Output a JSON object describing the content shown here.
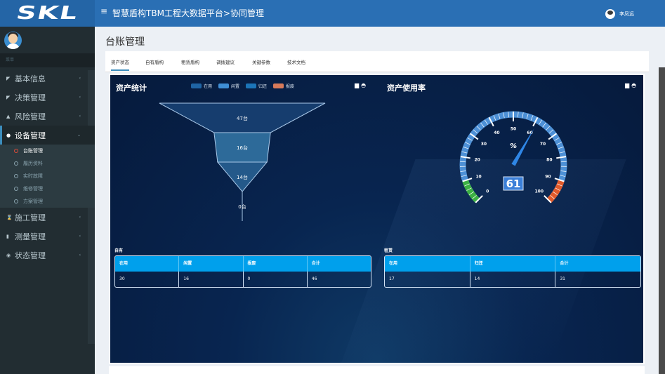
{
  "header": {
    "logo": "SKL",
    "title": "智慧盾构TBM工程大数据平台>协同管理",
    "user": "李凤远"
  },
  "sidebar": {
    "menu_header": "菜单",
    "items": [
      {
        "label": "基本信息"
      },
      {
        "label": "决策管理"
      },
      {
        "label": "风险管理"
      },
      {
        "label": "设备管理",
        "active": true,
        "children": [
          {
            "label": "台账管理",
            "active": true
          },
          {
            "label": "履历资料"
          },
          {
            "label": "实时故障"
          },
          {
            "label": "维修管理"
          },
          {
            "label": "方案管理"
          }
        ]
      },
      {
        "label": "施工管理"
      },
      {
        "label": "测量管理"
      },
      {
        "label": "状态管理"
      }
    ]
  },
  "page": {
    "title": "台账管理",
    "tabs": [
      "资产状态",
      "自有盾构",
      "租赁盾构",
      "调拨建议",
      "关键参数",
      "技术文档"
    ]
  },
  "stats": {
    "title": "资产统计",
    "legend": [
      {
        "label": "在用",
        "color": "#1f65a5"
      },
      {
        "label": "闲置",
        "color": "#3f8fd6"
      },
      {
        "label": "归还",
        "color": "#1c75b8"
      },
      {
        "label": "报废",
        "color": "#d77a5a"
      }
    ]
  },
  "usage": {
    "title": "资产使用率",
    "unit": "%"
  },
  "chart_data": [
    {
      "type": "funnel",
      "title": "资产统计",
      "categories": [
        "在用",
        "闲置",
        "归还",
        "报废"
      ],
      "values": [
        47,
        16,
        14,
        0
      ],
      "labels": [
        "47台",
        "16台",
        "14台",
        "0台"
      ]
    },
    {
      "type": "gauge",
      "title": "资产使用率",
      "value": 61,
      "min": 0,
      "max": 100,
      "ticks": [
        "0",
        "10",
        "20",
        "30",
        "40",
        "50",
        "60",
        "70",
        "80",
        "90",
        "100"
      ],
      "unit": "%"
    }
  ],
  "owned": {
    "label": "自有",
    "headers": [
      "在用",
      "闲置",
      "报废",
      "合计"
    ],
    "row": [
      "30",
      "16",
      "0",
      "46"
    ]
  },
  "leased": {
    "label": "租赁",
    "headers": [
      "在用",
      "归还",
      "合计"
    ],
    "row": [
      "17",
      "14",
      "31"
    ]
  }
}
